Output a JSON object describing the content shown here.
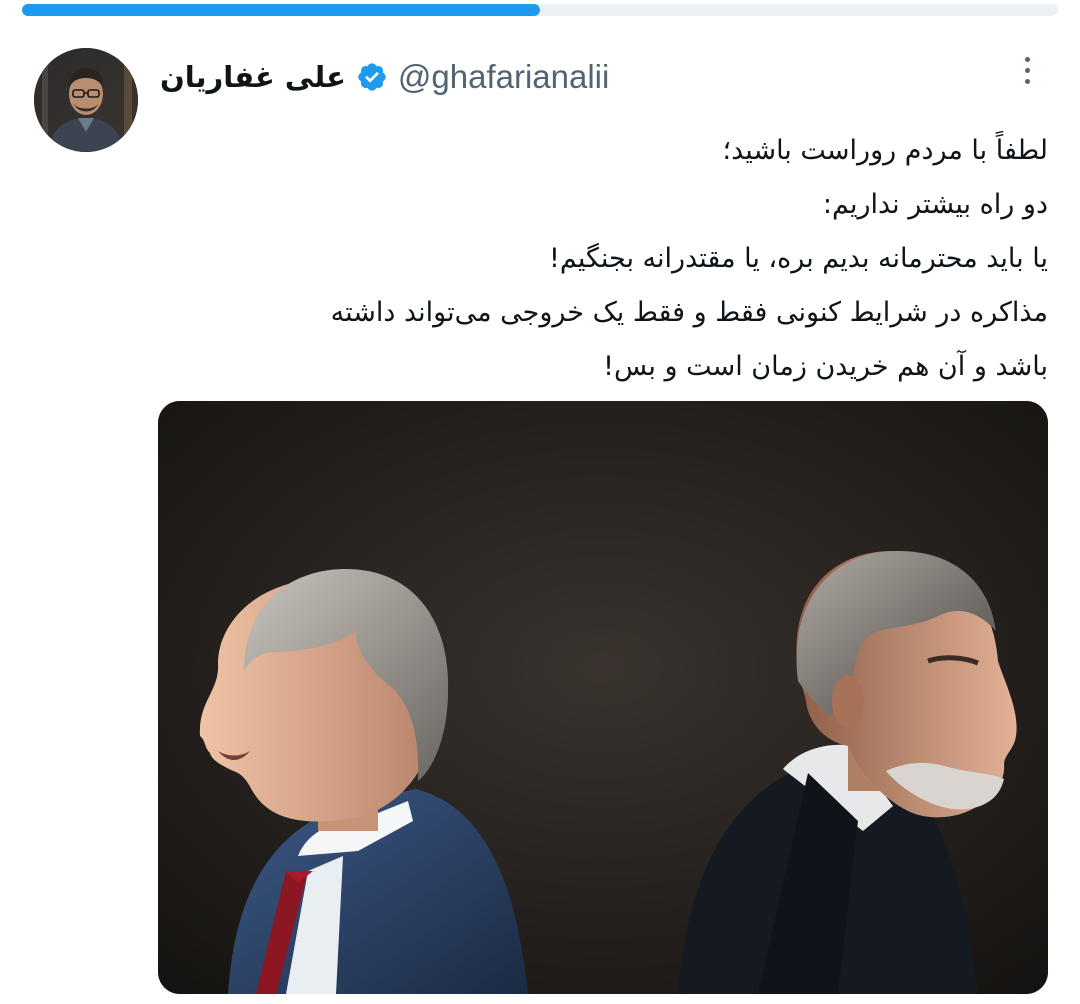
{
  "progress": {
    "fraction": 0.5,
    "accent_color": "#1d9bf0"
  },
  "tweet": {
    "author": {
      "display_name": "علی غفاریان",
      "handle": "@ghafarianalii",
      "verified": true,
      "verified_color": "#1d9bf0",
      "avatar_icon": "profile-photo"
    },
    "more_icon": "more-vertical-icon",
    "text_lines": [
      "لطفاً با مردم روراست باشید؛",
      "دو راه بیشتر نداریم:",
      "یا باید محترمانه بدیم بره، یا مقتدرانه بجنگیم!",
      "مذاکره در شرایط کنونی فقط و فقط یک خروجی می‌تواند داشته",
      "باشد و آن هم خریدن زمان است و بس!"
    ],
    "media": {
      "kind": "photo",
      "description_icon": "two-men-back-to-back-photo"
    }
  }
}
